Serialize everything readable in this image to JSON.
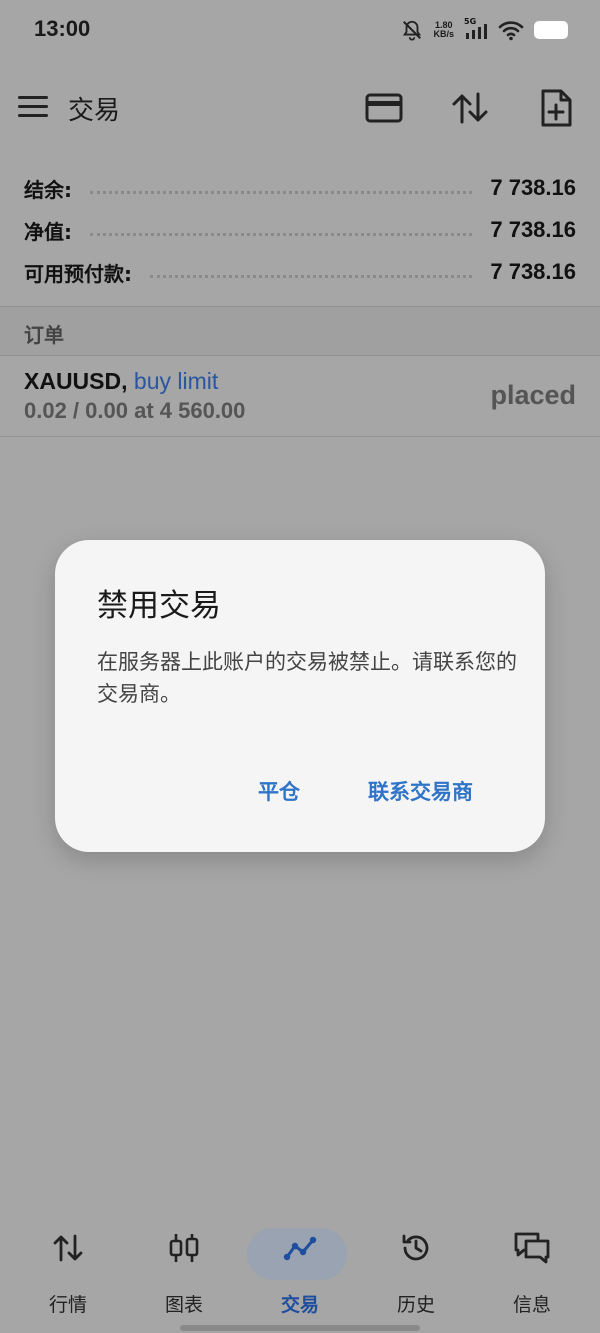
{
  "status": {
    "time": "13:00",
    "net_speed_top": "1.80",
    "net_speed_bottom": "KB/s",
    "signal_label": "5G"
  },
  "toolbar": {
    "title": "交易"
  },
  "summary": {
    "balance_label": "结余:",
    "balance_value": "7 738.16",
    "equity_label": "净值:",
    "equity_value": "7 738.16",
    "free_margin_label": "可用预付款:",
    "free_margin_value": "7 738.16"
  },
  "orders": {
    "header": "订单",
    "items": [
      {
        "symbol": "XAUUSD,",
        "type": "buy limit",
        "detail": "0.02 / 0.00 at 4 560.00",
        "status": "placed"
      }
    ]
  },
  "dialog": {
    "title": "禁用交易",
    "message": "在服务器上此账户的交易被禁止。请联系您的交易商。",
    "close_button": "平仓",
    "contact_button": "联系交易商"
  },
  "nav": {
    "items": [
      {
        "label": "行情",
        "icon": "quotes-arrows-icon"
      },
      {
        "label": "图表",
        "icon": "candlestick-chart-icon"
      },
      {
        "label": "交易",
        "icon": "trade-line-icon"
      },
      {
        "label": "历史",
        "icon": "history-clock-icon"
      },
      {
        "label": "信息",
        "icon": "messages-icon"
      }
    ],
    "active_index": 2
  },
  "colors": {
    "accent_blue": "#2f74c8",
    "order_type_blue": "#2a55a0",
    "overlay_gray": "#a6a6a6",
    "dialog_bg": "#f5f5f5"
  }
}
